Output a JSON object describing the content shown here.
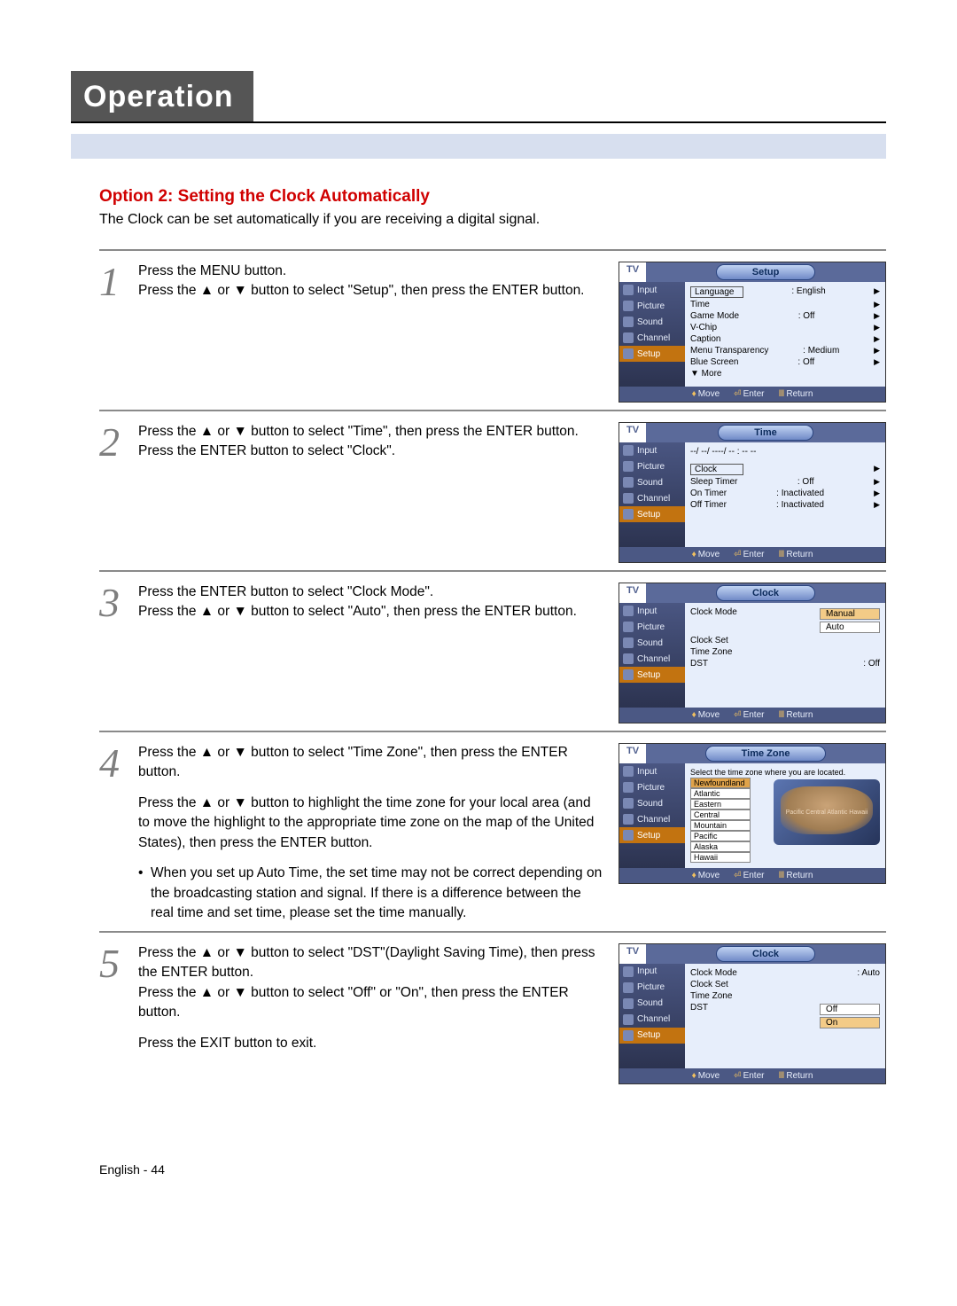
{
  "header": {
    "title": "Operation"
  },
  "option": {
    "title": "Option 2: Setting the Clock Automatically",
    "intro": "The Clock can be set automatically if you are receiving a digital signal."
  },
  "steps": {
    "s1": {
      "num": "1",
      "p1": "Press the MENU button.",
      "p2": "Press the ▲ or ▼ button to select \"Setup\", then press the ENTER button."
    },
    "s2": {
      "num": "2",
      "p1": "Press the ▲ or ▼ button to select \"Time\", then press the ENTER button.",
      "p2": "Press the ENTER button to select \"Clock\"."
    },
    "s3": {
      "num": "3",
      "p1": "Press the ENTER button to select \"Clock Mode\".",
      "p2": "Press the ▲ or ▼ button to select \"Auto\", then press the ENTER button."
    },
    "s4": {
      "num": "4",
      "p1": "Press the ▲ or ▼ button to select \"Time Zone\", then press the ENTER button.",
      "p2": "Press the ▲ or ▼ button to highlight the time zone for your local area (and to move the highlight to the appropriate time zone on the map of the United States), then press the ENTER button.",
      "bullet": "When you set up Auto Time, the set time may not be correct depending on the broadcasting station and signal. If there is a difference between the real time and set time, please set the time manually."
    },
    "s5": {
      "num": "5",
      "p1": "Press the ▲ or ▼ button to select \"DST\"(Daylight Saving Time), then press the ENTER button.",
      "p2": "Press the ▲ or ▼ button to select \"Off\" or \"On\", then press the ENTER button.",
      "p3": "Press the EXIT button to exit."
    }
  },
  "osd": {
    "nav": {
      "input": "Input",
      "picture": "Picture",
      "sound": "Sound",
      "channel": "Channel",
      "setup": "Setup"
    },
    "footer": {
      "move": "Move",
      "enter": "Enter",
      "return": "Return"
    },
    "tv": "TV",
    "screen1": {
      "title": "Setup",
      "language": "Language",
      "language_v": ": English",
      "time": "Time",
      "gamemode": "Game Mode",
      "gamemode_v": ": Off",
      "vchip": "V-Chip",
      "caption": "Caption",
      "transparency": "Menu Transparency",
      "transparency_v": ": Medium",
      "bluescreen": "Blue Screen",
      "bluescreen_v": ": Off",
      "more": "▼ More"
    },
    "screen2": {
      "title": "Time",
      "datetime": "--/ --/ ----/ -- : -- --",
      "clock": "Clock",
      "sleep": "Sleep Timer",
      "sleep_v": ": Off",
      "on": "On Timer",
      "on_v": ": Inactivated",
      "off": "Off Timer",
      "off_v": ": Inactivated"
    },
    "screen3": {
      "title": "Clock",
      "mode": "Clock Mode",
      "mode_opt1": "Manual",
      "mode_opt2": "Auto",
      "set": "Clock Set",
      "zone": "Time Zone",
      "dst": "DST",
      "dst_v": ": Off"
    },
    "screen4": {
      "title": "Time Zone",
      "hint": "Select the time zone where you are located.",
      "tz0": "Newfoundland",
      "tz1": "Atlantic",
      "tz2": "Eastern",
      "tz3": "Central",
      "tz4": "Mountain",
      "tz5": "Pacific",
      "tz6": "Alaska",
      "tz7": "Hawaii",
      "map_labels": "Pacific  Central  Atlantic  Hawaii"
    },
    "screen5": {
      "title": "Clock",
      "mode": "Clock Mode",
      "mode_v": ": Auto",
      "set": "Clock Set",
      "zone": "Time Zone",
      "dst": "DST",
      "dst_opt1": "Off",
      "dst_opt2": "On"
    }
  },
  "footer": {
    "page": "English - 44"
  }
}
